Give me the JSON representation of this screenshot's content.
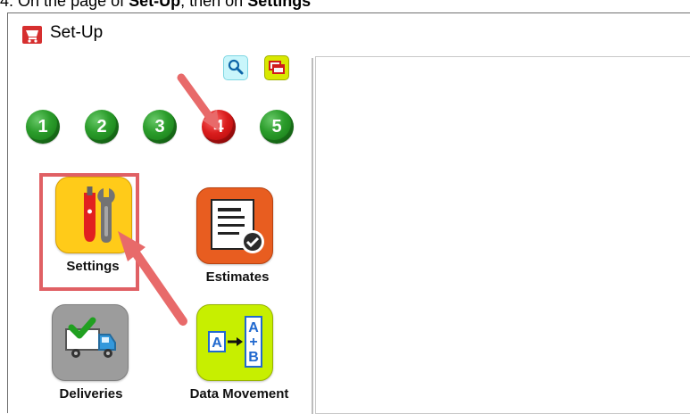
{
  "caption": {
    "text_before": "4. On the ",
    "text_page": "page",
    "text_middle": " of ",
    "bold_setup": "Set-Up",
    "text_after": ", then on ",
    "bold_settings": "Settings"
  },
  "window": {
    "title": "Set-Up",
    "icon": "shopping-cart-icon"
  },
  "toolbar": {
    "search_icon": "search-icon",
    "windows_icon": "cascade-windows-icon"
  },
  "steps": [
    {
      "label": "1",
      "color": "#2b9c2b",
      "current": false
    },
    {
      "label": "2",
      "color": "#2b9c2b",
      "current": false
    },
    {
      "label": "3",
      "color": "#2b9c2b",
      "current": false
    },
    {
      "label": "4",
      "color": "#d91d1d",
      "current": true
    },
    {
      "label": "5",
      "color": "#2b9c2b",
      "current": false
    }
  ],
  "tiles": [
    {
      "label": "Settings",
      "icon": "tools-icon",
      "color": "#ffcb19",
      "highlighted": true
    },
    {
      "label": "Estimates",
      "icon": "estimate-document-icon",
      "color": "#e85d20",
      "highlighted": false
    },
    {
      "label": "Deliveries",
      "icon": "delivery-truck-icon",
      "color": "#9c9c9c",
      "highlighted": false
    },
    {
      "label": "Data Movement",
      "icon": "data-movement-icon",
      "color": "#c7ef00",
      "highlighted": false
    }
  ],
  "annotation": {
    "highlight_color": "#e06064",
    "arrow_color": "#e86a6a"
  }
}
